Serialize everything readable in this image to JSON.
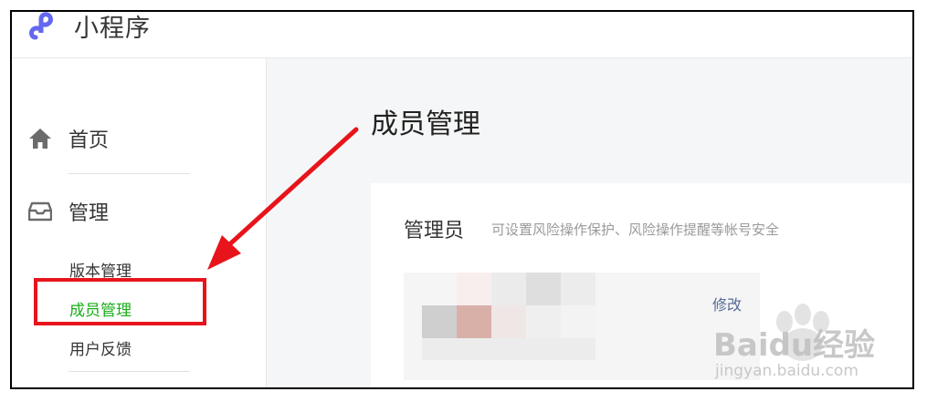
{
  "header": {
    "app_title": "小程序"
  },
  "sidebar": {
    "home_label": "首页",
    "manage_label": "管理",
    "sub_items": [
      "版本管理",
      "成员管理",
      "用户反馈"
    ]
  },
  "main": {
    "page_title": "成员管理",
    "card": {
      "title": "管理员",
      "description": "可设置风险操作保护、风险操作提醒等帐号安全",
      "edit_label": "修改"
    }
  },
  "watermark": {
    "brand": "Baidu经验",
    "url": "jingyan.baidu.com"
  },
  "colors": {
    "active": "#1aad19",
    "link": "#576b95",
    "highlight": "#e8141b"
  }
}
